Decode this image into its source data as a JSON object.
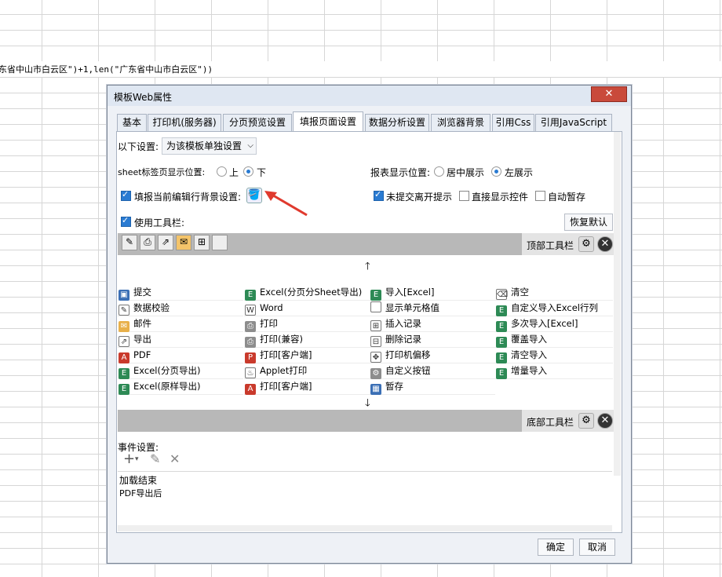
{
  "formula": "东省中山市白云区\")+1,len(\"广东省中山市白云区\"))",
  "dialog": {
    "title": "模板Web属性",
    "close_icon": "✕",
    "tabs": [
      {
        "label": "基本"
      },
      {
        "label": "打印机(服务器)"
      },
      {
        "label": "分页预览设置"
      },
      {
        "label": "填报页面设置",
        "active": true
      },
      {
        "label": "数据分析设置"
      },
      {
        "label": "浏览器背景"
      },
      {
        "label": "引用Css"
      },
      {
        "label": "引用JavaScript"
      }
    ],
    "settings": {
      "scope_label": "以下设置:",
      "scope_value": "为该模板单独设置",
      "sheet_pos_label": "sheet标签页显示位置:",
      "sheet_pos_top": "上",
      "sheet_pos_bottom": "下",
      "sheet_pos_selected": "下",
      "report_pos_label": "报表显示位置:",
      "report_pos_center": "居中展示",
      "report_pos_left": "左展示",
      "report_pos_selected": "左展示",
      "row_bg_label": "填报当前编辑行背景设置:",
      "row_bg_checked": true,
      "unsubmitted_label": "未提交离开提示",
      "unsubmitted_checked": true,
      "direct_display_label": "直接显示控件",
      "direct_display_checked": false,
      "autosave_label": "自动暂存",
      "autosave_checked": false,
      "use_toolbar_label": "使用工具栏:",
      "use_toolbar_checked": true,
      "restore_default": "恢复默认"
    },
    "top_toolbar_label": "顶部工具栏",
    "bottom_toolbar_label": "底部工具栏",
    "up_arrow": "🡑",
    "down_arrow": "🡓",
    "buttons": [
      [
        "提交",
        "Excel(分页分Sheet导出)",
        "导入[Excel]",
        "清空"
      ],
      [
        "数据校验",
        "Word",
        "显示单元格值",
        "自定义导入Excel行列"
      ],
      [
        "邮件",
        "打印",
        "插入记录",
        "多次导入[Excel]"
      ],
      [
        "导出",
        "打印(兼容)",
        "删除记录",
        "覆盖导入"
      ],
      [
        "PDF",
        "打印[客户端]",
        "打印机偏移",
        "清空导入"
      ],
      [
        "Excel(分页导出)",
        "Applet打印",
        "自定义按钮",
        "增量导入"
      ],
      [
        "Excel(原样导出)",
        "打印[客户端]",
        "暂存",
        ""
      ]
    ],
    "event_label": "事件设置:",
    "events": [
      "加载结束",
      "PDF导出后"
    ],
    "ok": "确定",
    "cancel": "取消"
  }
}
